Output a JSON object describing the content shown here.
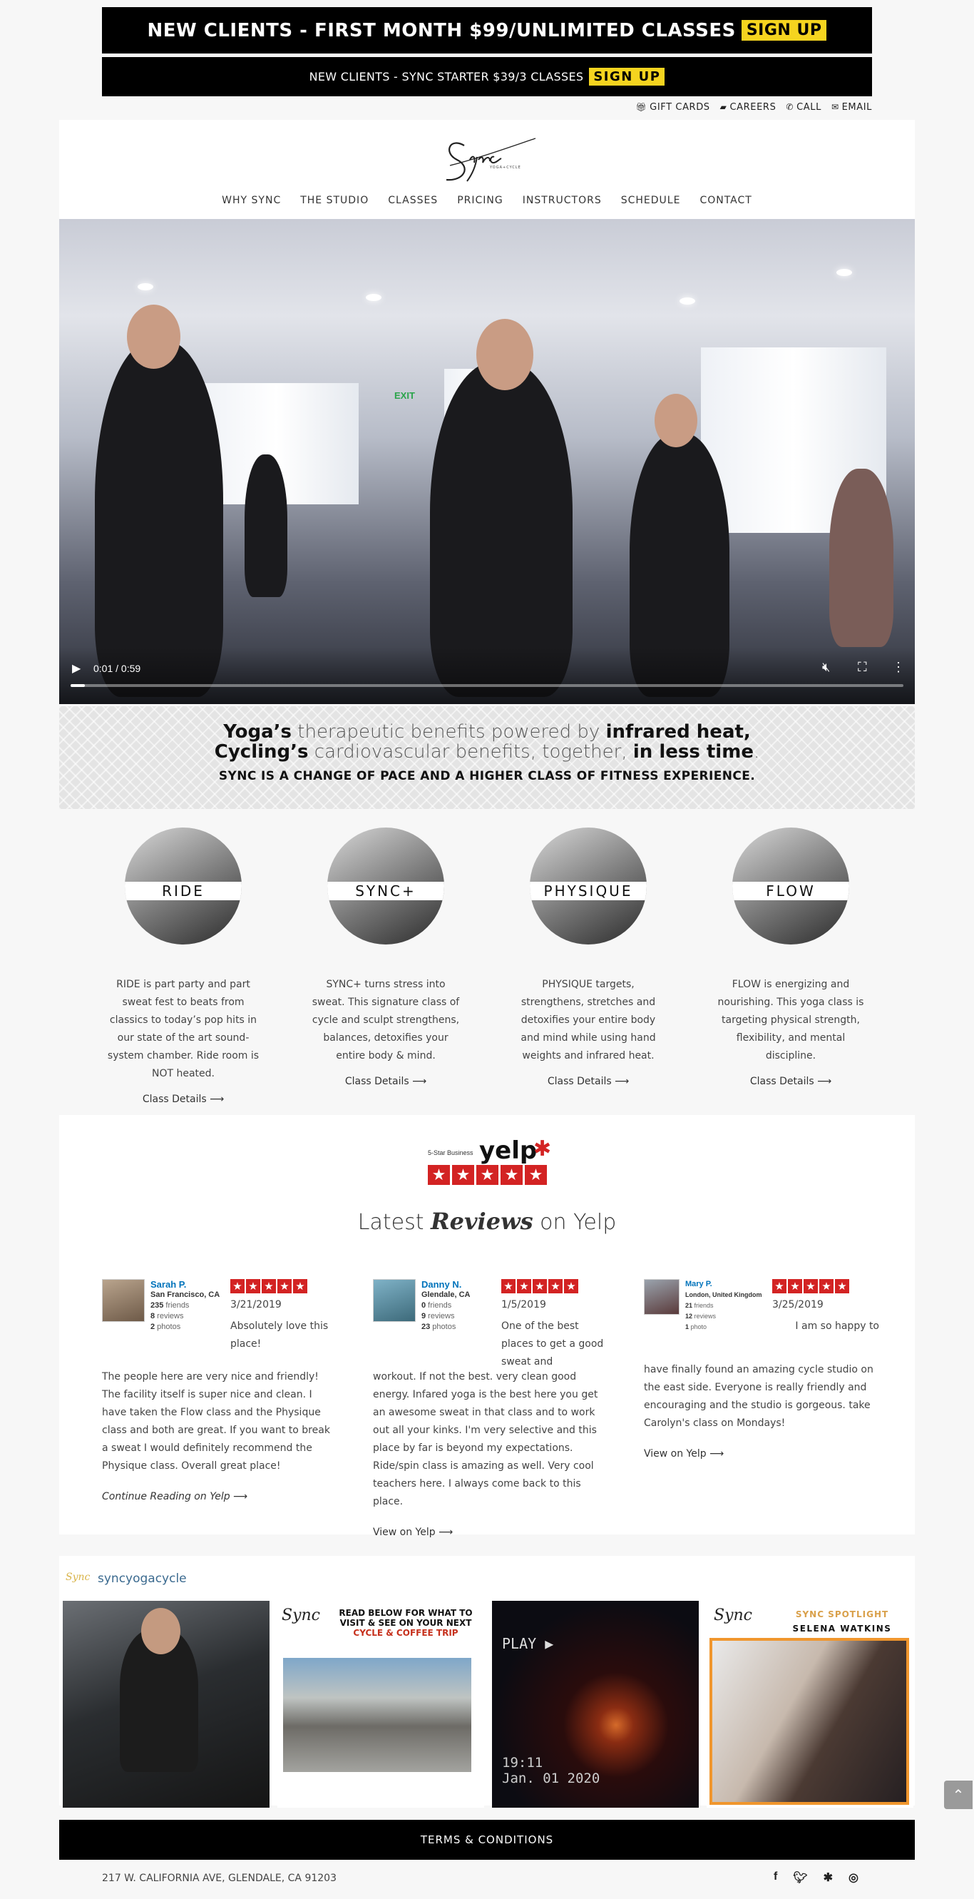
{
  "promo": {
    "line1": "NEW CLIENTS - FIRST MONTH $99/UNLIMITED CLASSES",
    "line1_cta": "SIGN UP",
    "line2": "NEW CLIENTS - SYNC STARTER $39/3 CLASSES",
    "line2_cta": "SIGN UP"
  },
  "toplinks": [
    {
      "icon": "gift-icon",
      "label": "GIFT CARDS"
    },
    {
      "icon": "graduation-cap-icon",
      "label": "CAREERS"
    },
    {
      "icon": "phone-icon",
      "label": "CALL"
    },
    {
      "icon": "envelope-icon",
      "label": "EMAIL"
    }
  ],
  "logo": {
    "text": "Sync",
    "subtext": "YOGA+CYCLE"
  },
  "nav": [
    "WHY SYNC",
    "THE STUDIO",
    "CLASSES",
    "PRICING",
    "INSTRUCTORS",
    "SCHEDULE",
    "CONTACT"
  ],
  "video": {
    "time": "0:01 / 0:59",
    "progress": 0.017,
    "exit_sign": "EXIT"
  },
  "tagline": {
    "yoga_bold": "Yoga’s",
    "yoga_light": " therapeutic benefits powered by ",
    "heat_bold": "infrared heat",
    "comma1": ",",
    "cycling_bold": "Cycling’s",
    "cycling_light": " cardiovascular benefits, together, ",
    "time_bold": "in less time",
    "period": ".",
    "sub": "SYNC IS A CHANGE OF PACE AND A HIGHER CLASS OF FITNESS EXPERIENCE."
  },
  "classes": [
    {
      "name": "RIDE",
      "desc": "RIDE is part party and part sweat fest to beats from classics to today’s pop hits in our state of the art sound-system chamber. Ride room is NOT heated.",
      "link": "Class Details ⟶"
    },
    {
      "name": "SYNC+",
      "desc": "SYNC+ turns stress into sweat. This signature class of cycle and sculpt strengthens, balances, detoxifies your entire body & mind.",
      "link": "Class Details ⟶"
    },
    {
      "name": "PHYSIQUE",
      "desc": "PHYSIQUE targets, strengthens, stretches and detoxifies your entire body and mind while using hand weights and infrared heat.",
      "link": "Class Details ⟶"
    },
    {
      "name": "FLOW",
      "desc": "FLOW is energizing and nourishing. This yoga class is targeting physical strength, flexibility, and mental discipline.",
      "link": "Class Details ⟶"
    }
  ],
  "reviews_section": {
    "badge_text": "5-Star Business",
    "badge_brand": "yelp",
    "title_pre": "Latest ",
    "title_em": "Reviews",
    "title_post": " on Yelp",
    "reviews": [
      {
        "name": "Sarah P.",
        "location": "San Francisco, CA",
        "friends": "235",
        "friends_label": " friends",
        "reviews_count": "8",
        "reviews_label": " reviews",
        "photos": "2",
        "photos_label": " photos",
        "date": "3/21/2019",
        "first": "Absolutely love this place!",
        "text": "The people here are very nice and friendly! The facility itself is super nice and clean. I have taken the Flow class and the Physique class and both are great. If you want to break a sweat I would definitely recommend the Physique class. Overall great place!",
        "link": "Continue Reading on Yelp ⟶"
      },
      {
        "name": "Danny N.",
        "location": "Glendale, CA",
        "friends": "0",
        "friends_label": " friends",
        "reviews_count": "9",
        "reviews_label": " reviews",
        "photos": "23",
        "photos_label": " photos",
        "date": "1/5/2019",
        "first": "One of the best places to get a good sweat and",
        "text": "workout. If not the best. very clean good energy. Infared yoga is the best here you get an awesome sweat in that class and to work out all your kinks. I'm very selective and this place by far is beyond my expectations. Ride/spin class is amazing as well. Very cool teachers here. I always come back to this place.",
        "link": "View on Yelp ⟶"
      },
      {
        "name": "Mary P.",
        "location": "London, United Kingdom",
        "friends": "21",
        "friends_label": " friends",
        "reviews_count": "12",
        "reviews_label": " reviews",
        "photos": "1",
        "photos_label": " photo",
        "date": "3/25/2019",
        "first": "I am so happy to",
        "text": "have finally found an amazing cycle studio on the east side. Everyone is really friendly and encouraging and the studio is gorgeous. take Carolyn's class on Mondays!",
        "link": "View on Yelp ⟶"
      }
    ]
  },
  "instagram": {
    "handle": "syncyogacycle",
    "tile2_heading": "READ BELOW FOR WHAT TO VISIT & SEE ON YOUR NEXT",
    "tile2_highlight": "CYCLE & COFFEE TRIP",
    "tile3_play": "PLAY ▶",
    "tile3_time": "19:11",
    "tile3_date": "Jan. 01 2020",
    "tile4_heading": "SYNC SPOTLIGHT",
    "tile4_name": "SELENA WATKINS"
  },
  "footer": {
    "terms": "TERMS & CONDITIONS",
    "address": "217 W. CALIFORNIA AVE, GLENDALE, CA 91203",
    "social": [
      "facebook-icon",
      "twitter-icon",
      "yelp-icon",
      "instagram-icon"
    ]
  },
  "colors": {
    "accent": "#f5d41f",
    "yelp_red": "#d32323",
    "link_blue": "#0073bb",
    "spotlight_orange": "#f0962d"
  }
}
